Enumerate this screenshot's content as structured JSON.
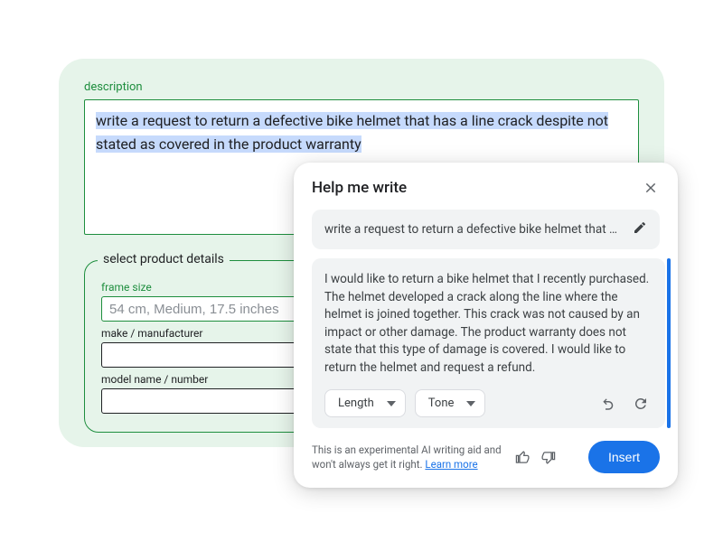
{
  "form": {
    "description_label": "description",
    "description_value": "write a request to return a defective bike helmet that has a line crack despite not stated as covered in the product warranty",
    "fieldset_legend": "select product details",
    "frame_size": {
      "label": "frame size",
      "value": "54 cm, Medium, 17.5 inches"
    },
    "make": {
      "label": "make / manufacturer",
      "value": ""
    },
    "model": {
      "label": "model name / number",
      "value": ""
    }
  },
  "popover": {
    "title": "Help me write",
    "prompt_preview": "write a request to return a defective bike helmet that has a…",
    "result_text": "I would like to return a bike helmet that I recently purchased. The helmet developed a crack along the line where the helmet is joined together. This crack was not caused by an impact or other damage. The product warranty does not state that this type of damage is covered. I would like to return the helmet and request a refund.",
    "length_label": "Length",
    "tone_label": "Tone",
    "disclaimer_prefix": "This is an experimental AI writing aid and won't always get it right. ",
    "learn_more": "Learn more",
    "insert_label": "Insert"
  }
}
